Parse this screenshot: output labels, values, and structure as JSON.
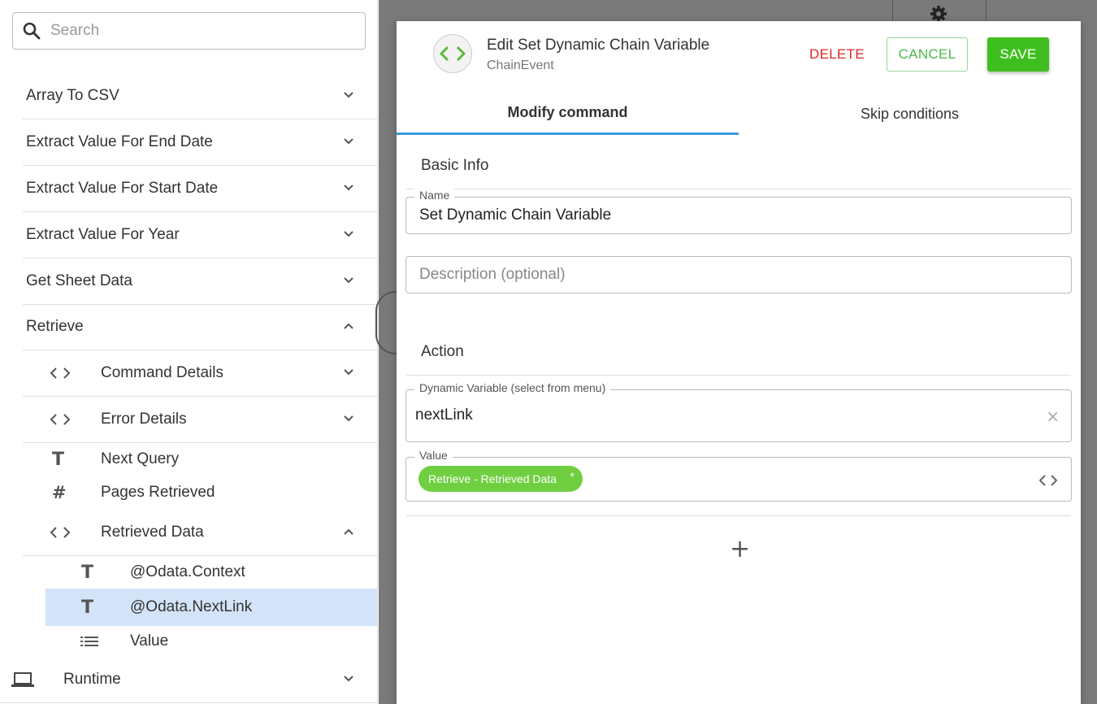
{
  "sidebar": {
    "search": {
      "placeholder": "Search"
    },
    "items": [
      {
        "label": "Array To CSV",
        "icon": "chevron-down-icon"
      },
      {
        "label": "Extract Value For End Date",
        "icon": "chevron-down-icon"
      },
      {
        "label": "Extract Value For Start Date",
        "icon": "chevron-down-icon"
      },
      {
        "label": "Extract Value For Year",
        "icon": "chevron-down-icon"
      },
      {
        "label": "Get Sheet Data",
        "icon": "chevron-down-icon"
      },
      {
        "label": "Retrieve",
        "icon": "chevron-up-icon"
      }
    ],
    "retrieve_children": [
      {
        "label": "Command Details",
        "icon": "code-icon"
      },
      {
        "label": "Error Details",
        "icon": "code-icon"
      },
      {
        "label": "Next Query",
        "icon": "text-type-icon"
      },
      {
        "label": "Pages Retrieved",
        "icon": "number-type-icon"
      },
      {
        "label": "Retrieved Data",
        "icon": "code-icon"
      }
    ],
    "retrieved_data_children": [
      {
        "label": "@Odata.Context",
        "icon": "text-type-icon"
      },
      {
        "label": "@Odata.NextLink",
        "icon": "text-type-icon",
        "selected": true
      },
      {
        "label": "Value",
        "icon": "list-icon"
      }
    ],
    "runtime": {
      "label": "Runtime",
      "icon": "laptop-icon"
    }
  },
  "modal": {
    "title": "Edit Set Dynamic Chain Variable",
    "subtitle": "ChainEvent",
    "buttons": {
      "delete": "DELETE",
      "cancel": "CANCEL",
      "save": "SAVE"
    },
    "tabs": [
      {
        "label": "Modify command",
        "active": true
      },
      {
        "label": "Skip conditions",
        "active": false
      }
    ],
    "basic_info": {
      "title": "Basic Info",
      "name_label": "Name",
      "name_value": "Set Dynamic Chain Variable",
      "description_placeholder": "Description (optional)"
    },
    "action": {
      "title": "Action",
      "variable_label": "Dynamic Variable (select from menu)",
      "variable_value": "nextLink",
      "value_label": "Value",
      "value_chip": "Retrieve - Retrieved Data",
      "chip_marker": "*"
    },
    "add_symbol": "+"
  },
  "colors": {
    "save": "#3fbf1f",
    "delete": "#e02424",
    "cancel": "#4cb84c",
    "tab_indicator": "#3b9bdc",
    "chip": "#6fcf40",
    "selected_row": "#d3e4f8"
  }
}
